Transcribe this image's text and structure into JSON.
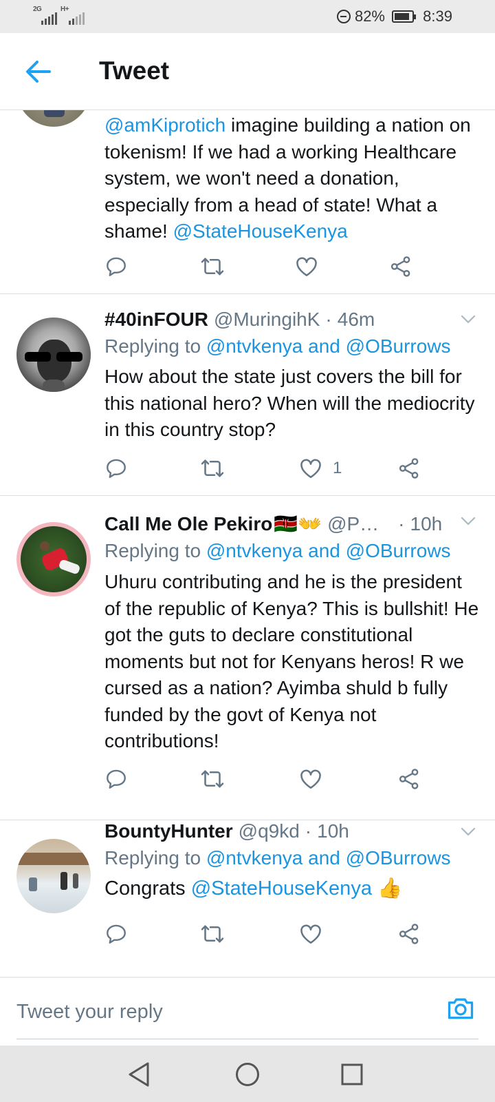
{
  "status_bar": {
    "signal1_label": "2G",
    "signal2_label": "H+",
    "battery_percent": "82%",
    "time": "8:39",
    "icons": [
      "signal-icon",
      "dnd-icon",
      "battery-icon"
    ]
  },
  "header": {
    "title": "Tweet",
    "back_icon": "arrow-left-icon",
    "accent_color": "#1da1f2"
  },
  "tweets": [
    {
      "body": [
        {
          "text": "@amKiprotich",
          "link": true
        },
        {
          "text": " imagine building a nation on tokenism! If we had a working Healthcare system, we won't need a donation, especially from a head of state! What a shame! ",
          "link": false
        },
        {
          "text": "@StateHouseKenya",
          "link": true
        }
      ],
      "likes": ""
    },
    {
      "name": "#40inFOUR",
      "handle": "@MuringihK",
      "separator": "·",
      "time": "46m",
      "reply_prefix": "Replying to",
      "reply_to": "@ntvkenya and @OBurrows",
      "body": "How about the state just covers the bill for this national hero? When will the mediocrity in this country stop?",
      "likes": "1"
    },
    {
      "name": "Call Me Ole Pekiro",
      "name_emoji": "🇰🇪👐",
      "handle": "@P…",
      "separator": "·",
      "time": "10h",
      "reply_prefix": "Replying to",
      "reply_to": "@ntvkenya and @OBurrows",
      "body": "Uhuru contributing and he is the president of the republic of Kenya? This is bullshit! He got the guts to declare constitutional moments but not for Kenyans heros! R we cursed as a nation? Ayimba shuld b fully funded by the govt of Kenya not contributions!",
      "likes": ""
    },
    {
      "name": "BountyHunter",
      "handle": "@q9kd",
      "separator": "·",
      "time": "10h",
      "reply_prefix": "Replying to",
      "reply_to": "@ntvkenya and @OBurrows",
      "body_prefix": "Congrats ",
      "body_link": "@StateHouseKenya",
      "body_emoji": "👍",
      "likes": ""
    }
  ],
  "actions": [
    "reply-icon",
    "retweet-icon",
    "like-icon",
    "share-icon"
  ],
  "reply_bar": {
    "placeholder": "Tweet your reply",
    "camera_icon": "camera-icon"
  },
  "nav_bar": {
    "icons": [
      "back-triangle-icon",
      "home-circle-icon",
      "recents-square-icon"
    ]
  }
}
